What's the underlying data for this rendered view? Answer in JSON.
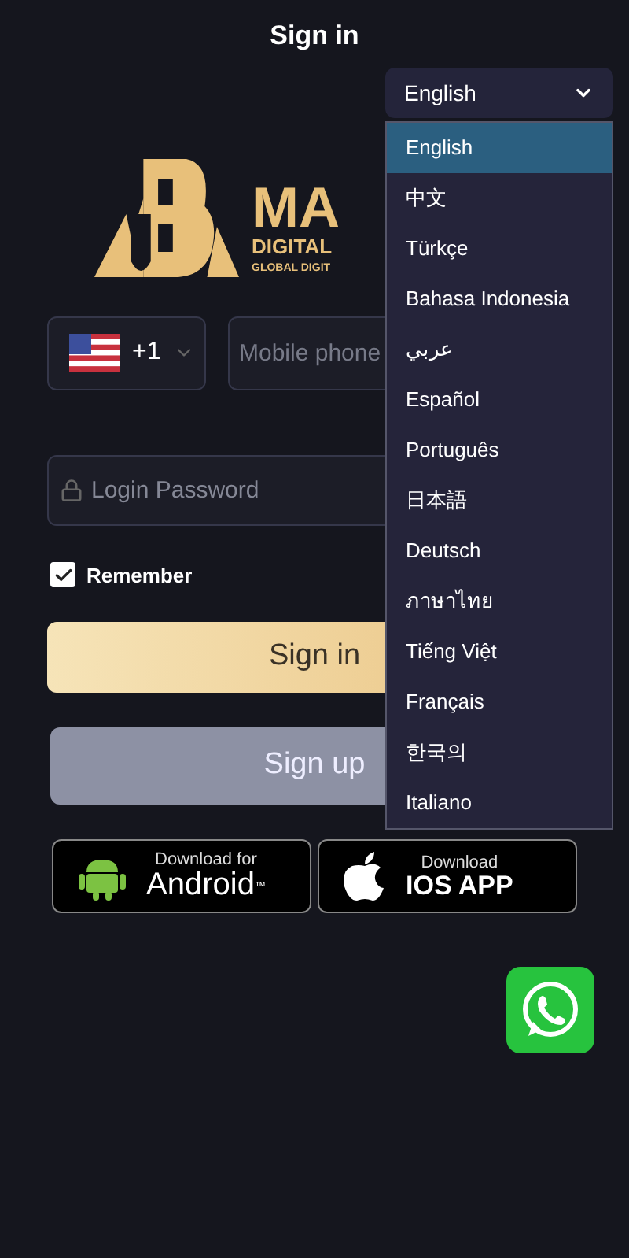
{
  "header": {
    "title": "Sign in"
  },
  "language_select": {
    "value": "English",
    "expanded": true,
    "options": [
      {
        "label": "English",
        "selected": true
      },
      {
        "label": "中文",
        "selected": false
      },
      {
        "label": "Türkçe",
        "selected": false
      },
      {
        "label": "Bahasa Indonesia",
        "selected": false
      },
      {
        "label": "عربي",
        "selected": false
      },
      {
        "label": "Español",
        "selected": false
      },
      {
        "label": "Português",
        "selected": false
      },
      {
        "label": "日本語",
        "selected": false
      },
      {
        "label": "Deutsch",
        "selected": false
      },
      {
        "label": "ภาษาไทย",
        "selected": false
      },
      {
        "label": "Tiếng Việt",
        "selected": false
      },
      {
        "label": "Français",
        "selected": false
      },
      {
        "label": "한국의",
        "selected": false
      },
      {
        "label": "Italiano",
        "selected": false
      }
    ]
  },
  "logo": {
    "wordmark": "MA",
    "line_1": "DIGITAL",
    "line_2": "GLOBAL DIGIT"
  },
  "form": {
    "country_code": "+1",
    "phone": {
      "placeholder": "Mobile phone"
    },
    "password": {
      "placeholder": "Login Password"
    },
    "remember": {
      "label": "Remember",
      "checked": true
    },
    "sign_in": "Sign in",
    "sign_up": "Sign up"
  },
  "downloads": [
    {
      "kind": "android",
      "small": "Download for",
      "big": "Android",
      "mark": "™"
    },
    {
      "kind": "ios",
      "small": "Download",
      "big": "IOS APP"
    }
  ]
}
